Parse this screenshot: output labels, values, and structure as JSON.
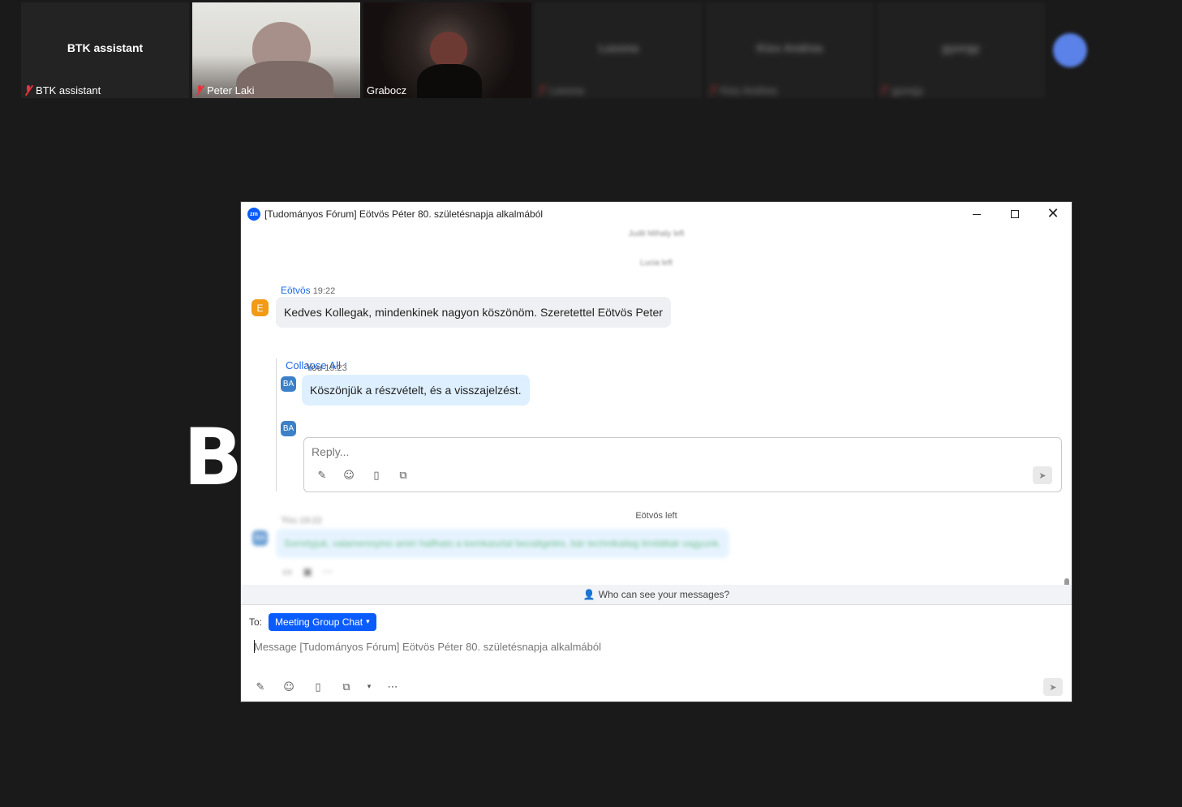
{
  "gallery": {
    "tiles": [
      {
        "center_name": "BTK assistant",
        "nametag": "BTK assistant",
        "muted": true
      },
      {
        "nametag": "Peter Laki",
        "muted": true
      },
      {
        "nametag": "Grabocz",
        "muted": false
      },
      {
        "center_name": "Lasona",
        "nametag": "Lasona",
        "muted": true
      },
      {
        "center_name": "Kiss Andrea",
        "nametag": "Kiss Andrea",
        "muted": true
      },
      {
        "center_name": "gyorgy",
        "nametag": "gyorgy",
        "muted": true
      }
    ]
  },
  "background_letter": "B",
  "chat_window": {
    "title": "[Tudományos Fórum] Eötvös Péter 80. születésnapja alkalmából",
    "system_lines": [
      "Judit Mihaly left",
      "Lucia left"
    ],
    "messages": [
      {
        "sender": "Eötvös",
        "time": "19:22",
        "avatar": "E",
        "text": "Kedves Kollegak, mindenkinek nagyon köszönöm. Szeretettel Eötvös Peter"
      }
    ],
    "thread": {
      "collapse_label": "Collapse All",
      "reply": {
        "sender": "You",
        "time": "19:23",
        "avatar": "BA",
        "text": "Köszönjük a részvételt, és a visszajelzést."
      },
      "reply_avatar": "BA",
      "reply_placeholder": "Reply..."
    },
    "left_note": "Eötvös left",
    "blurred_message": {
      "sender": "You",
      "time": "19:22",
      "avatar": "BA",
      "text": "Sorrelyjuk, valamennyino amiri hallhato a kemkasztal bezaltgetés, bár technikailag limitáltak vagyunk."
    },
    "who_can_see": "Who can see your messages?",
    "to_label": "To:",
    "recipient": "Meeting Group Chat",
    "message_placeholder": "Message [Tudományos Fórum] Eötvös Péter 80. születésnapja alkalmából"
  },
  "colors": {
    "accent": "#0b5cff",
    "muted_mic": "#e0353b",
    "background": "#1a1a1a"
  }
}
